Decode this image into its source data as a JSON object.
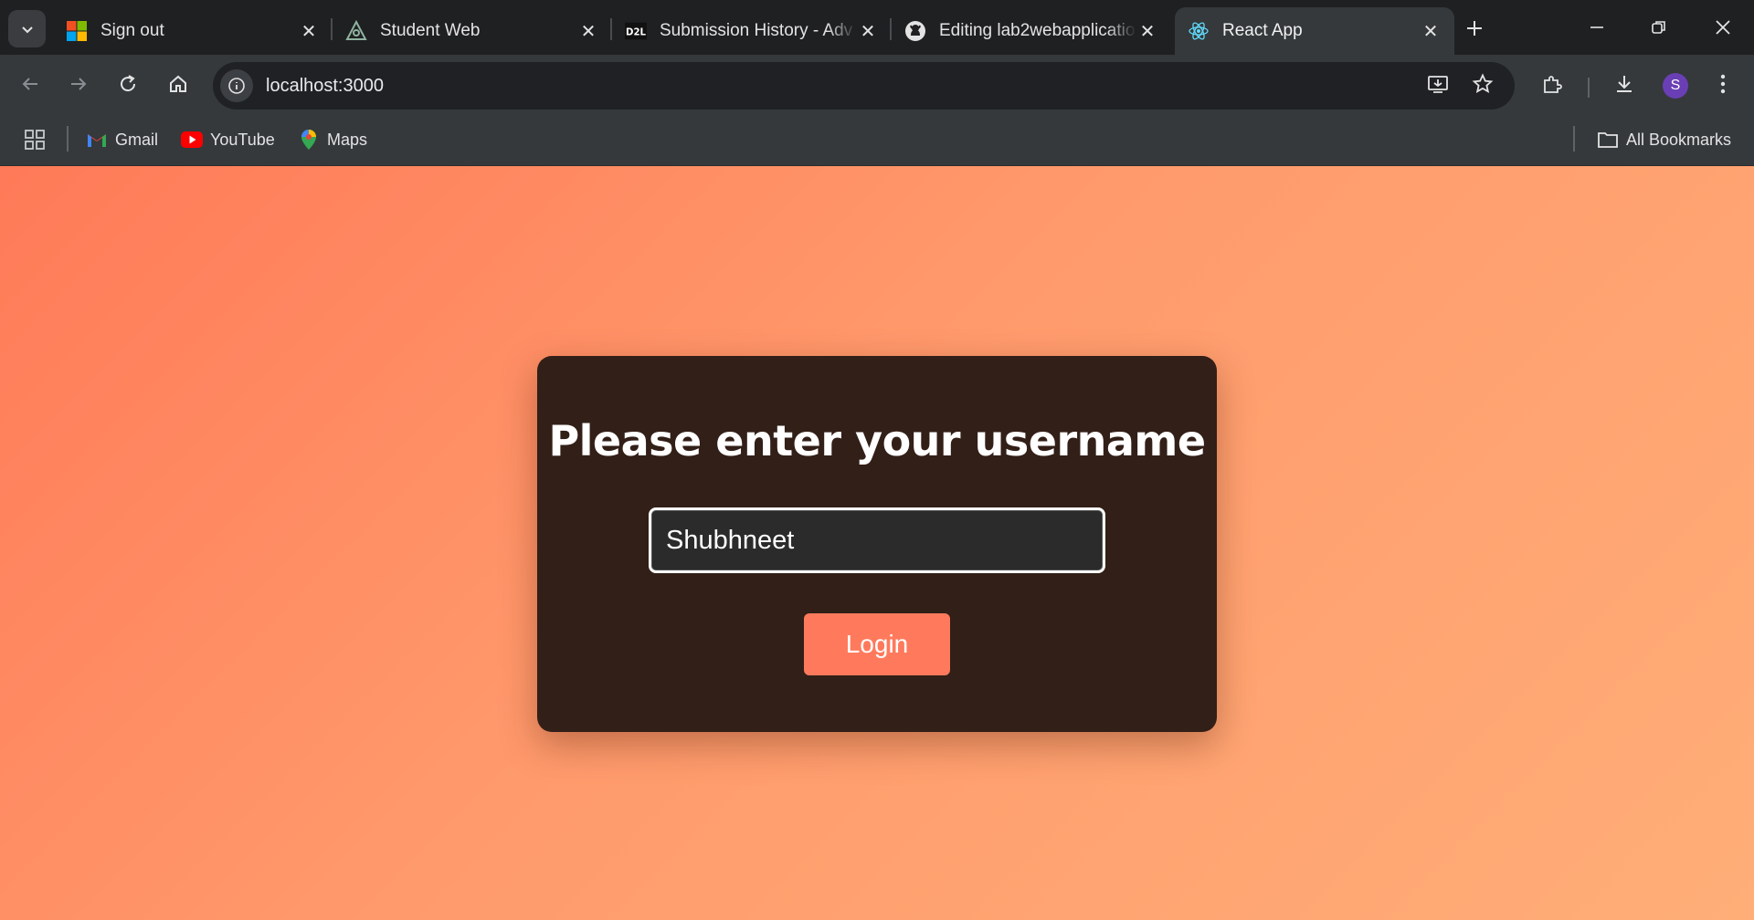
{
  "tabs": [
    {
      "title": "Sign out",
      "icon": "microsoft-icon"
    },
    {
      "title": "Student Web",
      "icon": "student-web-icon"
    },
    {
      "title": "Submission History - Adv",
      "icon": "d2l-icon"
    },
    {
      "title": "Editing lab2webapplicatio",
      "icon": "github-icon"
    },
    {
      "title": "React App",
      "icon": "react-icon",
      "active": true
    }
  ],
  "addressbar": {
    "url": "localhost:3000"
  },
  "profile": {
    "initial": "S",
    "color": "#6a3fb5"
  },
  "bookmarks": [
    {
      "label": "Gmail",
      "icon": "gmail-icon"
    },
    {
      "label": "YouTube",
      "icon": "youtube-icon"
    },
    {
      "label": "Maps",
      "icon": "maps-icon"
    }
  ],
  "all_bookmarks_label": "All Bookmarks",
  "login": {
    "heading": "Please enter your username",
    "username_value": "Shubhneet",
    "button_label": "Login"
  },
  "colors": {
    "card_background": "#321f18",
    "button_background": "#ff7a5c",
    "page_gradient_start": "#ff7a58",
    "page_gradient_end": "#ffae78"
  }
}
